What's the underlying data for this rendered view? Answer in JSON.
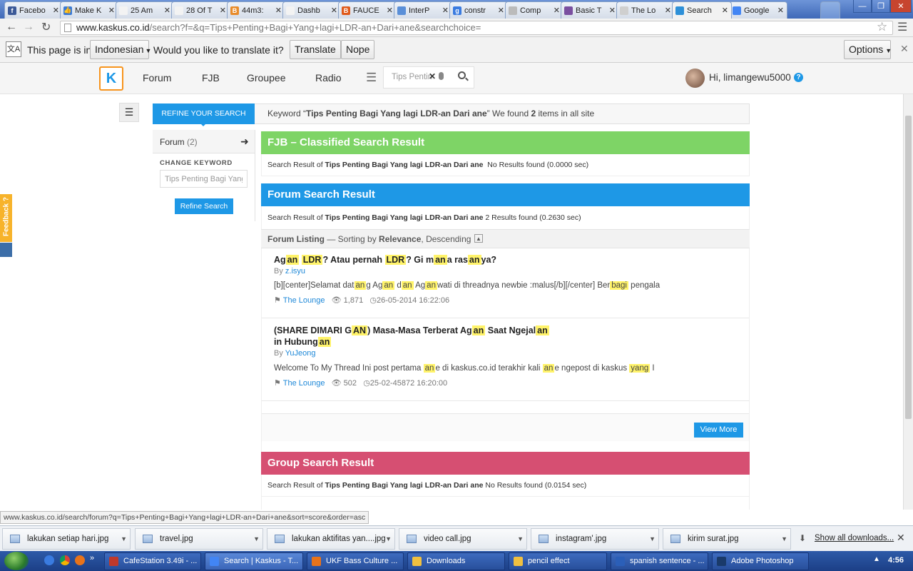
{
  "browser": {
    "tabs": [
      {
        "title": "Facebo",
        "fav": "f",
        "color": "#3b5998"
      },
      {
        "title": "Make K",
        "fav": "👍",
        "color": "#3b7bd6"
      },
      {
        "title": "25 Am",
        "fav": "",
        "color": "#f3f3f3"
      },
      {
        "title": "28 Of T",
        "fav": "",
        "color": "#f3f3f3"
      },
      {
        "title": "44m3:",
        "fav": "B",
        "color": "#e88b2a"
      },
      {
        "title": "Dashb",
        "fav": "",
        "color": "#f3f3f3"
      },
      {
        "title": "FAUCE",
        "fav": "B",
        "color": "#e05a1a"
      },
      {
        "title": "InterP",
        "fav": "",
        "color": "#5a8fd8"
      },
      {
        "title": "constr",
        "fav": "g",
        "color": "#3a7be0"
      },
      {
        "title": "Comp",
        "fav": "",
        "color": "#bbb"
      },
      {
        "title": "Basic T",
        "fav": "",
        "color": "#7a4fa0"
      },
      {
        "title": "The Lo",
        "fav": "",
        "color": "#cfcfcf"
      },
      {
        "title": "Search",
        "fav": "",
        "color": "#2e90d8"
      },
      {
        "title": "Google",
        "fav": "",
        "color": "#4285f4"
      }
    ],
    "url_host": "www.kaskus.co.id",
    "url_path": "/search?f=&q=Tips+Penting+Bagi+Yang+lagi+LDR-an+Dari+ane&searchchoice="
  },
  "translate_bar": {
    "prefix": "This page is in",
    "language": "Indonesian",
    "question": "Would you like to translate it?",
    "translate": "Translate",
    "nope": "Nope",
    "options": "Options"
  },
  "site": {
    "logo": "K",
    "nav": [
      "Forum",
      "FJB",
      "Groupee",
      "Radio"
    ],
    "search_value": "Tips Pentin",
    "greeting": "Hi, limangewu5000",
    "help": "?"
  },
  "sidebar": {
    "refine_tab": "REFINE YOUR SEARCH",
    "forum_label": "Forum",
    "forum_count": "(2)",
    "change_keyword": "CHANGE KEYWORD",
    "keyword_value": "Tips Penting Bagi Yang lagi LDR-an Dari ane",
    "refine_button": "Refine Search",
    "feedback": "Feedback ?"
  },
  "summary": {
    "keyword_prefix": "Keyword “",
    "keyword": "Tips Penting Bagi Yang lagi LDR-an Dari ane",
    "mid": "” We found ",
    "count": "2",
    "suffix": " items in all site"
  },
  "fjb": {
    "title": "FJB – Classified Search Result",
    "prefix": "Search Result of ",
    "query": "Tips Penting Bagi Yang lagi LDR-an Dari ane",
    "result": "No Results found (0.0000 sec)",
    "color": "#7ed466"
  },
  "forum": {
    "title": "Forum Search Result",
    "prefix": "Search Result of ",
    "query": "Tips Penting Bagi Yang lagi LDR-an Dari ane",
    "result": "2 Results found (0.2630 sec)",
    "color": "#1e98e6",
    "listing_label": "Forum Listing",
    "listing_sort": " — Sorting by ",
    "listing_key": "Relevance",
    "listing_order": ", Descending",
    "posts": [
      {
        "title_parts": [
          [
            "Ag",
            0
          ],
          [
            "an",
            1
          ],
          [
            " ",
            0
          ],
          [
            "LDR",
            1
          ],
          [
            "? Atau pernah ",
            0
          ],
          [
            "LDR",
            1
          ],
          [
            "? Gi m",
            0
          ],
          [
            "an",
            1
          ],
          [
            "a ras",
            0
          ],
          [
            "an",
            1
          ],
          [
            "ya?",
            0
          ]
        ],
        "by": "By",
        "author": "z.isyu",
        "snippet_parts": [
          [
            "[b][center]Selamat dat",
            0
          ],
          [
            "an",
            1
          ],
          [
            "g Ag",
            0
          ],
          [
            "an",
            1
          ],
          [
            " d",
            0
          ],
          [
            "an",
            1
          ],
          [
            " Ag",
            0
          ],
          [
            "an",
            1
          ],
          [
            "wati di threadnya newbie :malus[/b][/center] Ber",
            0
          ],
          [
            "bagi",
            1
          ],
          [
            " pengala",
            0
          ]
        ],
        "category": "The Lounge",
        "views": "1,871",
        "date": "26-05-2014 16:22:06"
      },
      {
        "title_line1": [
          [
            "(SHARE DIMARI G",
            0
          ],
          [
            "AN",
            1
          ],
          [
            ") Masa-Masa Terberat Ag",
            0
          ],
          [
            "an",
            1
          ],
          [
            " Saat Ngejal",
            0
          ],
          [
            "an",
            1
          ]
        ],
        "title_line2": [
          [
            "in Hubung",
            0
          ],
          [
            "an",
            1
          ]
        ],
        "by": "By",
        "author": "YuJeong",
        "snippet_parts": [
          [
            "Welcome To My Thread Ini post pertama ",
            0
          ],
          [
            "an",
            1
          ],
          [
            "e di kaskus.co.id terakhir kali ",
            0
          ],
          [
            "an",
            1
          ],
          [
            "e ngepost di kaskus ",
            0
          ],
          [
            "yang",
            1
          ],
          [
            " I",
            0
          ]
        ],
        "category": "The Lounge",
        "views": "502",
        "date": "25-02-45872 16:20:00"
      }
    ],
    "view_more": "View More"
  },
  "group": {
    "title": "Group Search Result",
    "prefix": "Search Result of ",
    "query": "Tips Penting Bagi Yang lagi LDR-an Dari ane",
    "result": "No Results found (0.0154 sec)",
    "color": "#d64f72"
  },
  "status_url": "www.kaskus.co.id/search/forum?q=Tips+Penting+Bagi+Yang+lagi+LDR-an+Dari+ane&sort=score&order=asc",
  "downloads": {
    "items": [
      "lakukan setiap hari.jpg",
      "travel.jpg",
      "lakukan aktifitas yan....jpg",
      "video call.jpg",
      "instagram'.jpg",
      "kirim surat.jpg"
    ],
    "show_all": "Show all downloads..."
  },
  "taskbar": {
    "items": [
      {
        "label": "CafeStation 3.49i - ...",
        "color": "#c0392b"
      },
      {
        "label": "Search | Kaskus - T...",
        "color": "#4285f4"
      },
      {
        "label": "UKF Bass Culture ...",
        "color": "#e8731a"
      },
      {
        "label": "Downloads",
        "color": "#f0c040"
      },
      {
        "label": "pencil effect",
        "color": "#f0c040"
      },
      {
        "label": "spanish sentence - ...",
        "color": "#2b5fb8"
      },
      {
        "label": "Adobe Photoshop",
        "color": "#1a3a6a"
      }
    ],
    "clock": "4:56"
  }
}
